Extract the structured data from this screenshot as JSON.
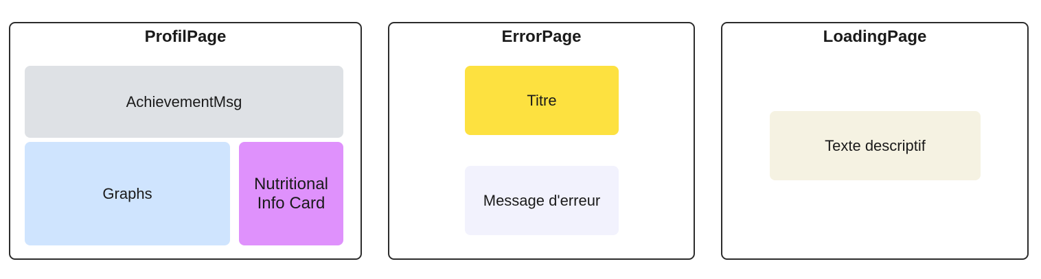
{
  "colors": {
    "frame_border": "#2b2b2b",
    "achievement": "#dee1e5",
    "graphs": "#cfe4fe",
    "nutrition": "#df91fc",
    "titre": "#fde140",
    "message": "#f2f2fd",
    "texte": "#f5f2e2"
  },
  "profil_page": {
    "title": "ProfilPage",
    "achievement": "AchievementMsg",
    "graphs": "Graphs",
    "nutrition_line1": "Nutritional",
    "nutrition_line2": "Info Card"
  },
  "error_page": {
    "title": "ErrorPage",
    "titre": "Titre",
    "message": "Message d'erreur"
  },
  "loading_page": {
    "title": "LoadingPage",
    "texte": "Texte descriptif"
  }
}
